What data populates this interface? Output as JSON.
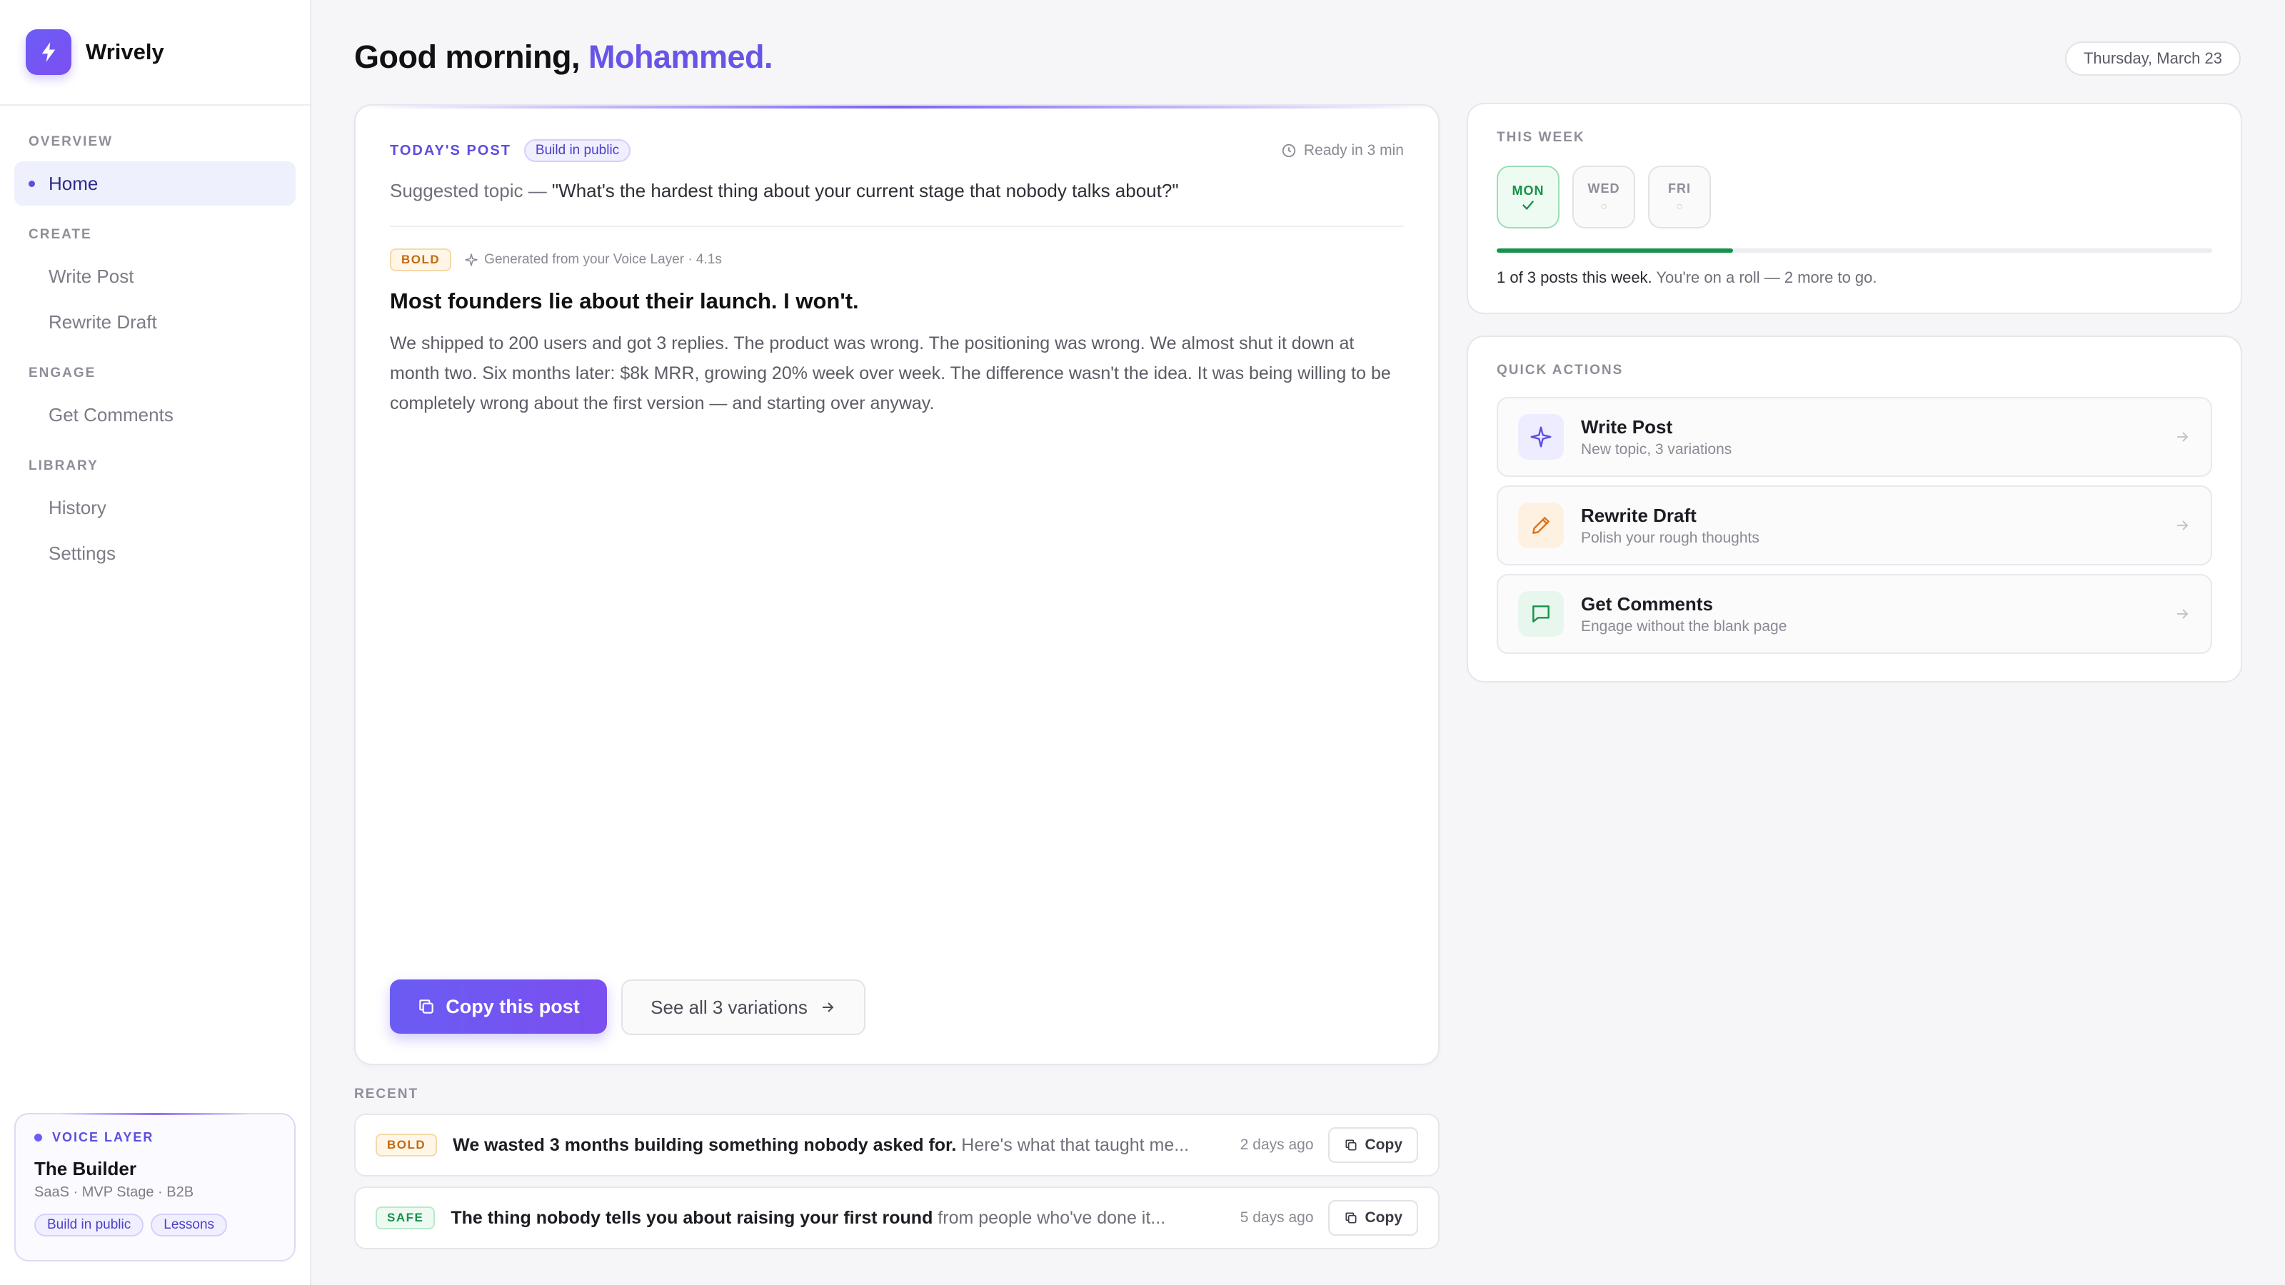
{
  "app": {
    "name": "Wrively"
  },
  "sidebar": {
    "sections": [
      {
        "label": "OVERVIEW",
        "items": [
          {
            "label": "Home"
          }
        ]
      },
      {
        "label": "CREATE",
        "items": [
          {
            "label": "Write Post"
          },
          {
            "label": "Rewrite Draft"
          }
        ]
      },
      {
        "label": "ENGAGE",
        "items": [
          {
            "label": "Get Comments"
          }
        ]
      },
      {
        "label": "LIBRARY",
        "items": [
          {
            "label": "History"
          },
          {
            "label": "Settings"
          }
        ]
      }
    ],
    "active_item": "Home"
  },
  "voice_layer": {
    "label": "VOICE LAYER",
    "name": "The Builder",
    "meta": "SaaS · MVP Stage · B2B",
    "tags": [
      "Build in public",
      "Lessons"
    ]
  },
  "header": {
    "greeting": "Good morning,",
    "user_name": "Mohammed.",
    "date": "Thursday, March 23"
  },
  "todays_post": {
    "label": "TODAY'S POST",
    "tag": "Build in public",
    "ready": "Ready in 3 min",
    "topic_prefix": "Suggested topic — ",
    "topic": "\"What's the hardest thing about your current stage that nobody talks about?\"",
    "badge": "BOLD",
    "generated": "Generated from your Voice Layer · 4.1s",
    "title": "Most founders lie about their launch. I won't.",
    "body": "We shipped to 200 users and got 3 replies. The product was wrong. The positioning was wrong. We almost shut it down at month two. Six months later: $8k MRR, growing 20% week over week. The difference wasn't the idea. It was being willing to be completely wrong about the first version — and starting over anyway.",
    "copy_button": "Copy this post",
    "variations_button": "See all 3 variations"
  },
  "recent": {
    "label": "RECENT",
    "items": [
      {
        "badge": "BOLD",
        "title": "We wasted 3 months building something nobody asked for.",
        "preview": "Here's what that taught me...",
        "time": "2 days ago",
        "copy": "Copy"
      },
      {
        "badge": "SAFE",
        "title": "The thing nobody tells you about raising your first round",
        "preview": "from people who've done it...",
        "time": "5 days ago",
        "copy": "Copy"
      }
    ]
  },
  "this_week": {
    "label": "THIS WEEK",
    "days": [
      {
        "label": "MON",
        "done": true
      },
      {
        "label": "WED",
        "done": false,
        "mark": "○"
      },
      {
        "label": "FRI",
        "done": false,
        "mark": "○"
      }
    ],
    "progress_fraction": 0.33,
    "summary_strong": "1 of 3 posts this week.",
    "summary_rest": "You're on a roll — 2 more to go."
  },
  "quick_actions": {
    "label": "QUICK ACTIONS",
    "items": [
      {
        "title": "Write Post",
        "subtitle": "New topic, 3 variations",
        "icon": "sparkle-icon"
      },
      {
        "title": "Rewrite Draft",
        "subtitle": "Polish your rough thoughts",
        "icon": "pencil-icon"
      },
      {
        "title": "Get Comments",
        "subtitle": "Engage without the blank page",
        "icon": "chat-icon"
      }
    ]
  },
  "colors": {
    "accent": "#6655e6",
    "success": "#17924a",
    "warning": "#c46a12"
  }
}
